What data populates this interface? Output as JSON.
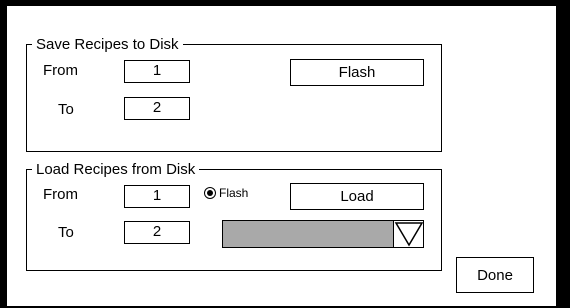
{
  "save_group": {
    "title": "Save Recipes to Disk",
    "from_label": "From",
    "from_value": "1",
    "to_label": "To",
    "to_value": "2",
    "flash_button_label": "Flash"
  },
  "load_group": {
    "title": "Load Recipes from Disk",
    "from_label": "From",
    "from_value": "1",
    "to_label": "To",
    "to_value": "2",
    "flash_radio_label": "Flash",
    "flash_radio_selected": true,
    "load_button_label": "Load",
    "dropdown_value": ""
  },
  "done_button_label": "Done",
  "colors": {
    "background": "#000000",
    "dialog": "#ffffff",
    "dropdown_fill": "#a9a9a9"
  }
}
